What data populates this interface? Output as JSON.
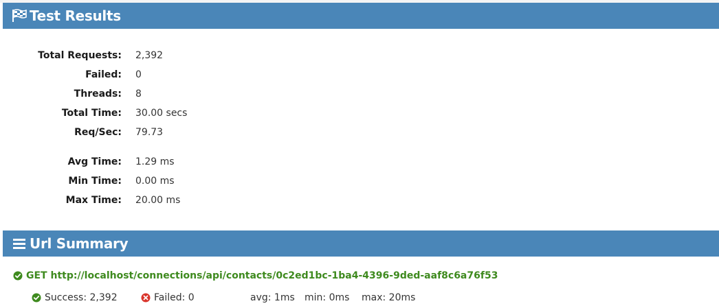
{
  "results_panel": {
    "title": "Test Results",
    "icon": "flag-checkered-icon"
  },
  "stats": [
    {
      "label": "Total Requests:",
      "value": "2,392"
    },
    {
      "label": "Failed:",
      "value": "0"
    },
    {
      "label": "Threads:",
      "value": "8"
    },
    {
      "label": "Total Time:",
      "value": "30.00 secs"
    },
    {
      "label": "Req/Sec:",
      "value": "79.73"
    },
    {
      "label": "Avg Time:",
      "value": "1.29 ms"
    },
    {
      "label": "Min Time:",
      "value": "0.00 ms"
    },
    {
      "label": "Max Time:",
      "value": "20.00 ms"
    }
  ],
  "url_panel": {
    "title": "Url Summary",
    "icon": "list-icon"
  },
  "urls": [
    {
      "status_icon": "check-circle-icon",
      "request": "GET http://localhost/connections/api/contacts/0c2ed1bc-1ba4-4396-9ded-aaf8c6a76f53",
      "success": "Success: 2,392",
      "failed": "Failed: 0",
      "avg": "avg: 1ms",
      "min": "min: 0ms",
      "max": "max: 20ms"
    }
  ],
  "colors": {
    "header_bg": "#4a86b8",
    "success_green": "#3e8a1e",
    "failed_red": "#d9342b"
  }
}
